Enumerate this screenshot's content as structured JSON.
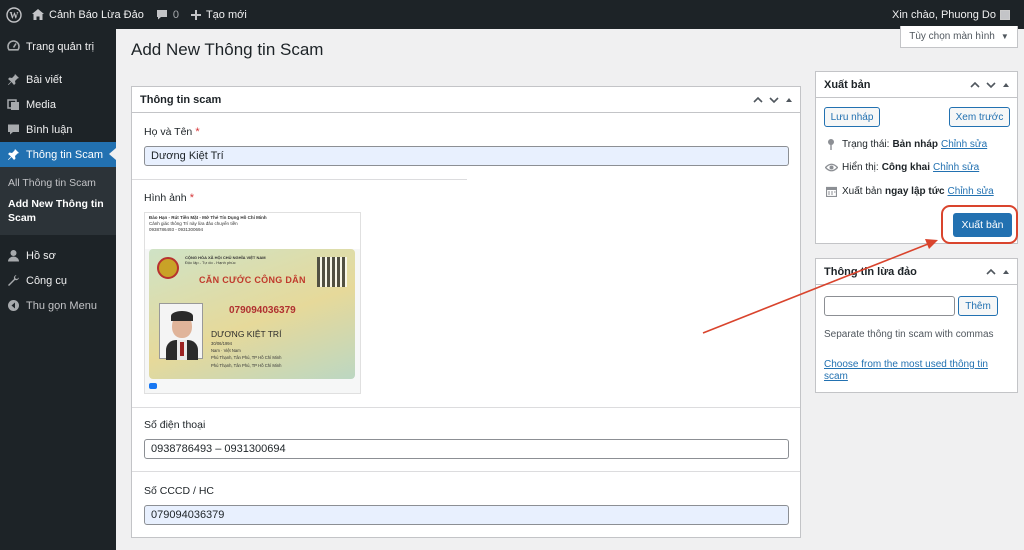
{
  "adminbar": {
    "site_name": "Cảnh Báo Lừa Đảo",
    "comments_count": "0",
    "new_label": "Tạo mới",
    "greeting": "Xin chào, Phuong Do"
  },
  "sidebar": {
    "items": [
      {
        "label": "Trang quản trị",
        "icon": "dashboard-icon"
      },
      {
        "label": "Bài viết",
        "icon": "pin-icon"
      },
      {
        "label": "Media",
        "icon": "media-icon"
      },
      {
        "label": "Bình luận",
        "icon": "comment-icon"
      },
      {
        "label": "Thông tin Scam",
        "icon": "pin-icon"
      },
      {
        "label": "Hồ sơ",
        "icon": "user-icon"
      },
      {
        "label": "Công cụ",
        "icon": "wrench-icon"
      },
      {
        "label": "Thu gọn Menu",
        "icon": "collapse-icon"
      }
    ],
    "submenu": [
      {
        "label": "All Thông tin Scam"
      },
      {
        "label": "Add New Thông tin Scam"
      }
    ]
  },
  "page": {
    "title": "Add New Thông tin Scam",
    "screen_options": "Tùy chọn màn hình"
  },
  "main_box": {
    "title": "Thông tin scam",
    "fields": {
      "name_label": "Họ và Tên",
      "name_value": "Dương Kiệt Trí",
      "image_label": "Hình ảnh",
      "phone_label": "Số điện thoại",
      "phone_value": "0938786493 – 0931300694",
      "id_label": "Số CCCD / HC",
      "id_value": "079094036379"
    },
    "required_mark": "*"
  },
  "id_card_image": {
    "post_header": "Đào Hạn - Rút Tiền Mặt - Mở Thẻ Tín Dụng Hồ Chí Minh",
    "post_caption": "Cảnh giác thông Trí này lừa đảo chuyển tiền",
    "post_phones": "0938786493 - 0931300694",
    "card_country": "CỘNG HÒA XÃ HỘI CHỦ NGHĨA VIỆT NAM",
    "card_motto": "Độc lập - Tự do - Hạnh phúc",
    "card_title": "CĂN CƯỚC CÔNG DÂN",
    "card_number": "079094036379",
    "card_name": "DƯƠNG KIỆT TRÍ",
    "card_dob": "30/06/1994",
    "card_sex": "Nam",
    "card_nationality": "Việt Nam",
    "card_origin": "Phú Thạnh, Tân Phú, TP Hồ Chí Minh",
    "card_residence": "Phú Thạnh, Tân Phú, TP Hồ Chí Minh"
  },
  "publish_box": {
    "title": "Xuất bản",
    "save_draft": "Lưu nháp",
    "preview": "Xem trước",
    "status_label": "Trạng thái:",
    "status_value": "Bản nháp",
    "visibility_label": "Hiển thị:",
    "visibility_value": "Công khai",
    "schedule_label": "Xuất bản",
    "schedule_value": "ngay lập tức",
    "edit_link": "Chỉnh sửa",
    "publish_button": "Xuất bản"
  },
  "tax_box": {
    "title": "Thông tin lừa đảo",
    "add_button": "Thêm",
    "input_value": "",
    "help_text": "Separate thông tin scam with commas",
    "choose_link": "Choose from the most used thông tin scam"
  },
  "colors": {
    "admin_dark": "#1d2327",
    "accent_blue": "#2271b1",
    "highlight_red": "#d9442d"
  }
}
